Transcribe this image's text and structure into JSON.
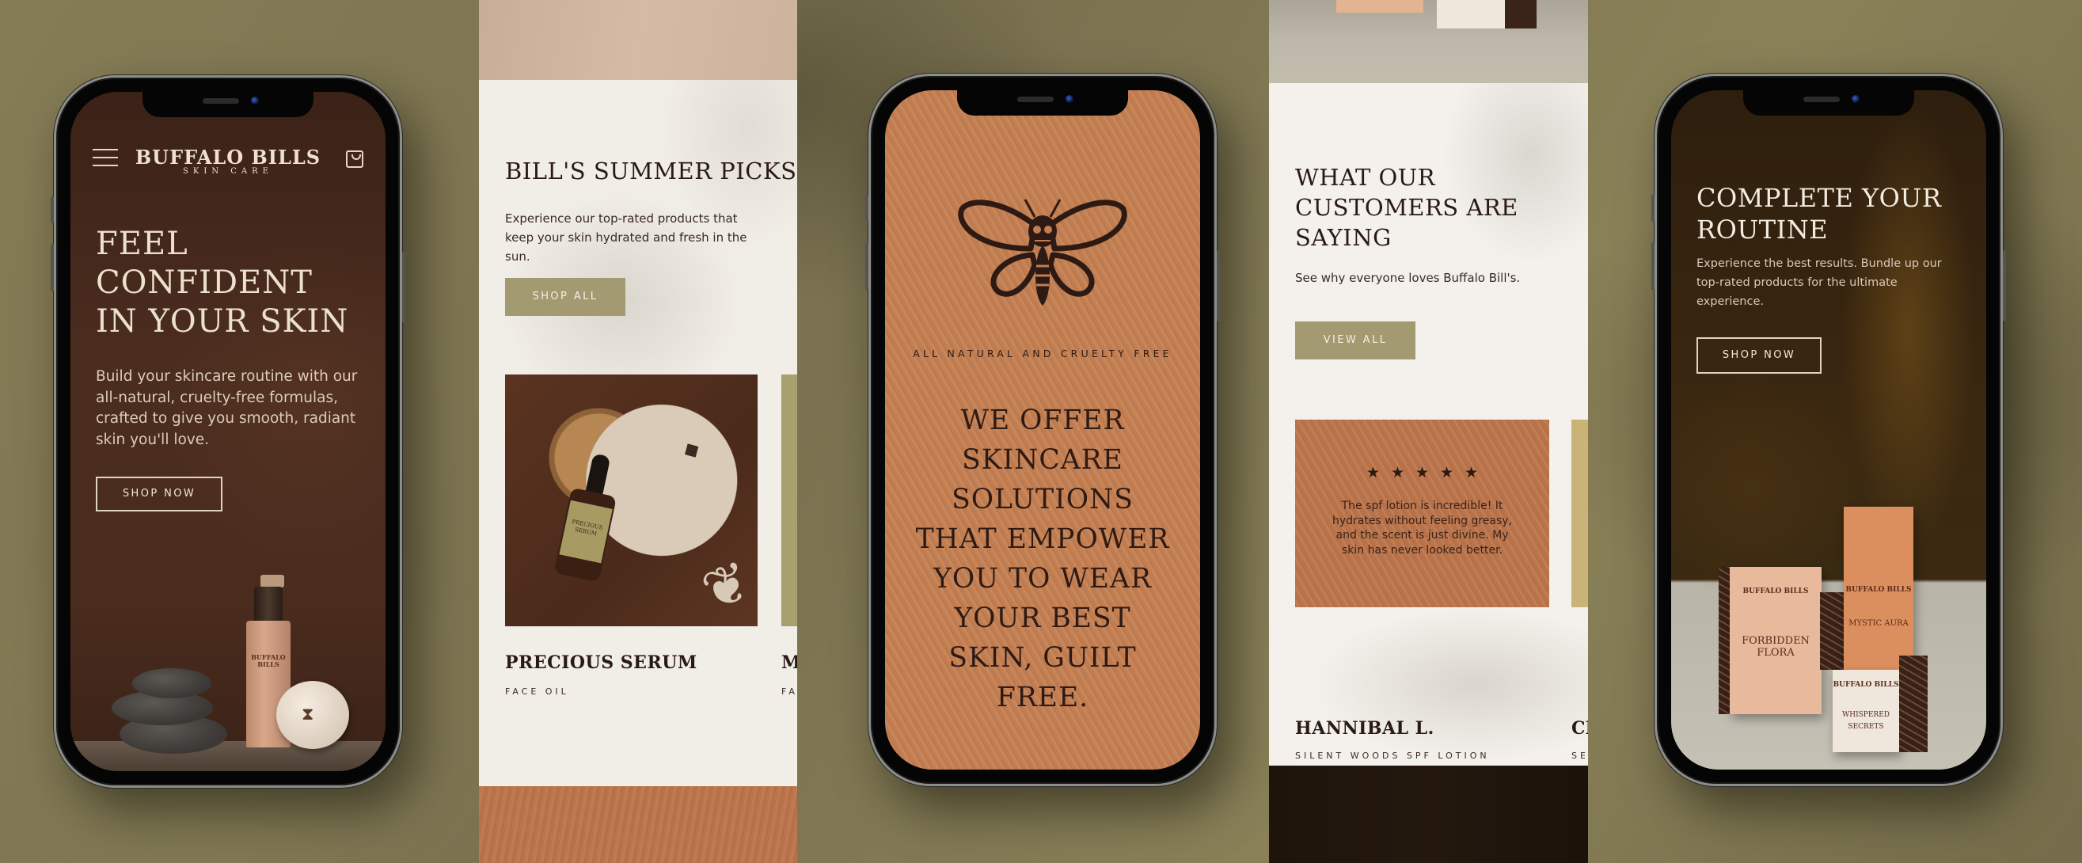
{
  "brand": {
    "name": "BUFFALO BILLS",
    "tagline": "SKIN CARE",
    "colors": {
      "olive": "#a39a72",
      "terracotta": "#c17e53",
      "dark_brown": "#2a1a14",
      "cream": "#f3efe9"
    }
  },
  "screen_home": {
    "nav": {
      "menu_icon": "hamburger-icon",
      "cart_icon": "shopping-bag-icon"
    },
    "hero_title": "FEEL CONFIDENT IN YOUR SKIN",
    "hero_body": "Build your skincare routine with our all-natural, cruelty-free formulas, crafted to give you smooth, radiant skin you'll love.",
    "cta_label": "SHOP NOW",
    "product_bottle_label": "BUFFALO BILLS"
  },
  "screen_summer_picks": {
    "title": "BILL'S SUMMER PICKS",
    "body": "Experience our top-rated products that keep your skin hydrated and fresh in the sun.",
    "cta_label": "SHOP ALL",
    "products": [
      {
        "name": "PRECIOUS SERUM",
        "category": "FACE OIL",
        "label_text": "PRECIOUS SERUM"
      },
      {
        "name": "M",
        "category": "FA"
      }
    ]
  },
  "screen_mission": {
    "emblem_icon": "skull-moth-icon",
    "tagline": "ALL NATURAL AND CRUELTY FREE",
    "statement": "WE OFFER SKINCARE SOLUTIONS THAT EMPOWER YOU TO WEAR YOUR BEST SKIN, GUILT FREE."
  },
  "screen_reviews": {
    "title": "WHAT OUR CUSTOMERS ARE SAYING",
    "body": "See why everyone loves Buffalo Bill's.",
    "cta_label": "VIEW ALL",
    "reviews": [
      {
        "rating": 5,
        "stars": "★★★★★",
        "text": "The spf lotion is incredible! It hydrates without feeling greasy, and the scent is just divine. My skin has never looked better.",
        "author": "HANNIBAL L.",
        "product": "SILENT WOODS SPF LOTION"
      },
      {
        "author": "CL",
        "product": "SE"
      }
    ]
  },
  "screen_routine": {
    "title": "COMPLETE YOUR ROUTINE",
    "body": "Experience the best results. Bundle up our top-rated products for the ultimate experience.",
    "cta_label": "SHOP NOW",
    "boxes": [
      {
        "brand": "BUFFALO BILLS",
        "name": "FORBIDDEN FLORA"
      },
      {
        "brand": "BUFFALO BILLS",
        "name": "MYSTIC AURA"
      },
      {
        "brand": "BUFFALO BILLS",
        "name": "WHISPERED SECRETS"
      }
    ]
  }
}
